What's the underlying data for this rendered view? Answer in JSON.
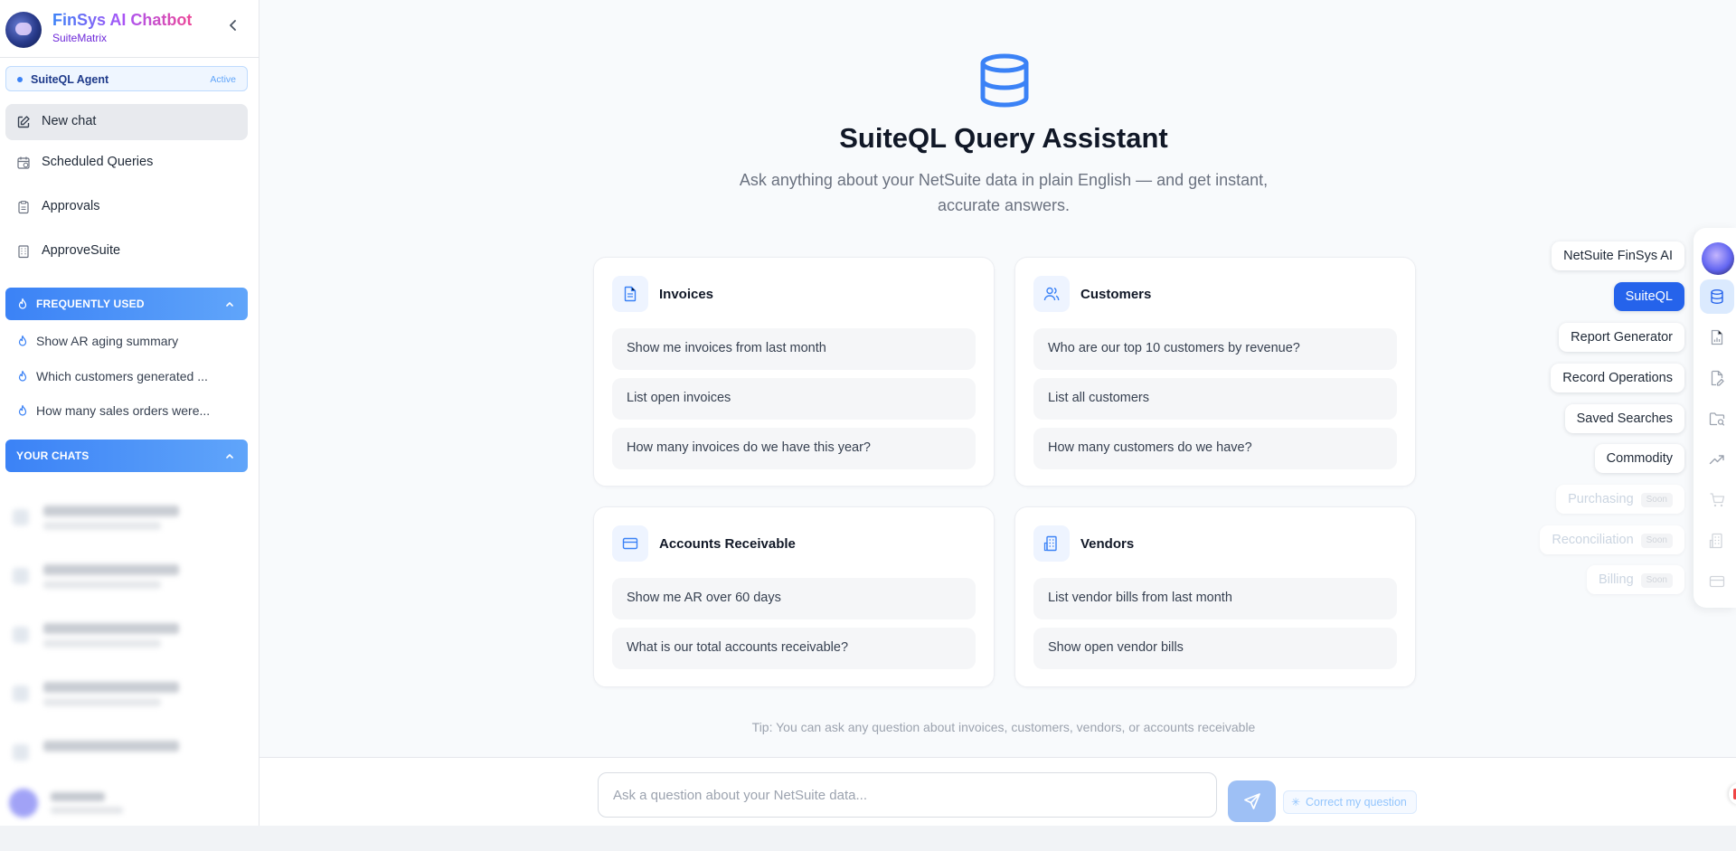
{
  "brand": {
    "title": "FinSys AI Chatbot",
    "subtitle": "SuiteMatrix"
  },
  "agent": {
    "name": "SuiteQL Agent",
    "status": "Active"
  },
  "nav": [
    {
      "label": "New chat",
      "icon": "edit-icon"
    },
    {
      "label": "Scheduled Queries",
      "icon": "calendar-clock-icon"
    },
    {
      "label": "Approvals",
      "icon": "clipboard-icon"
    },
    {
      "label": "ApproveSuite",
      "icon": "building-icon"
    }
  ],
  "frequently_used": {
    "title": "FREQUENTLY USED",
    "items": [
      "Show AR aging summary",
      "Which customers generated ...",
      "How many sales orders were..."
    ]
  },
  "your_chats": {
    "title": "YOUR CHATS"
  },
  "hero": {
    "title": "SuiteQL Query Assistant",
    "subtitle": "Ask anything about your NetSuite data in plain English — and get instant, accurate answers."
  },
  "cards": [
    {
      "title": "Invoices",
      "icon": "document-icon",
      "questions": [
        "Show me invoices from last month",
        "List open invoices",
        "How many invoices do we have this year?"
      ]
    },
    {
      "title": "Customers",
      "icon": "users-icon",
      "questions": [
        "Who are our top 10 customers by revenue?",
        "List all customers",
        "How many customers do we have?"
      ]
    },
    {
      "title": "Accounts Receivable",
      "icon": "credit-card-icon",
      "questions": [
        "Show me AR over 60 days",
        "What is our total accounts receivable?"
      ]
    },
    {
      "title": "Vendors",
      "icon": "building-icon",
      "questions": [
        "List vendor bills from last month",
        "Show open vendor bills"
      ]
    }
  ],
  "tip": "Tip: You can ask any question about invoices, customers, vendors, or accounts receivable",
  "composer": {
    "placeholder": "Ask a question about your NetSuite data...",
    "correct_label": "Correct my question"
  },
  "rail": {
    "items": [
      {
        "label": "NetSuite FinSys AI",
        "icon": "avatar-icon",
        "state": "normal"
      },
      {
        "label": "SuiteQL",
        "icon": "database-icon",
        "state": "active"
      },
      {
        "label": "Report Generator",
        "icon": "file-chart-icon",
        "state": "normal"
      },
      {
        "label": "Record Operations",
        "icon": "file-edit-icon",
        "state": "normal"
      },
      {
        "label": "Saved Searches",
        "icon": "folder-search-icon",
        "state": "normal"
      },
      {
        "label": "Commodity",
        "icon": "trending-up-icon",
        "state": "normal"
      },
      {
        "label": "Purchasing",
        "icon": "cart-icon",
        "state": "soon"
      },
      {
        "label": "Reconciliation",
        "icon": "building-icon",
        "state": "soon"
      },
      {
        "label": "Billing",
        "icon": "credit-card-icon",
        "state": "soon"
      }
    ],
    "soon_tag": "Soon"
  },
  "colors": {
    "accent": "#2563eb",
    "brand_gradient_start": "#3b82f6",
    "brand_gradient_end": "#ec4899"
  }
}
